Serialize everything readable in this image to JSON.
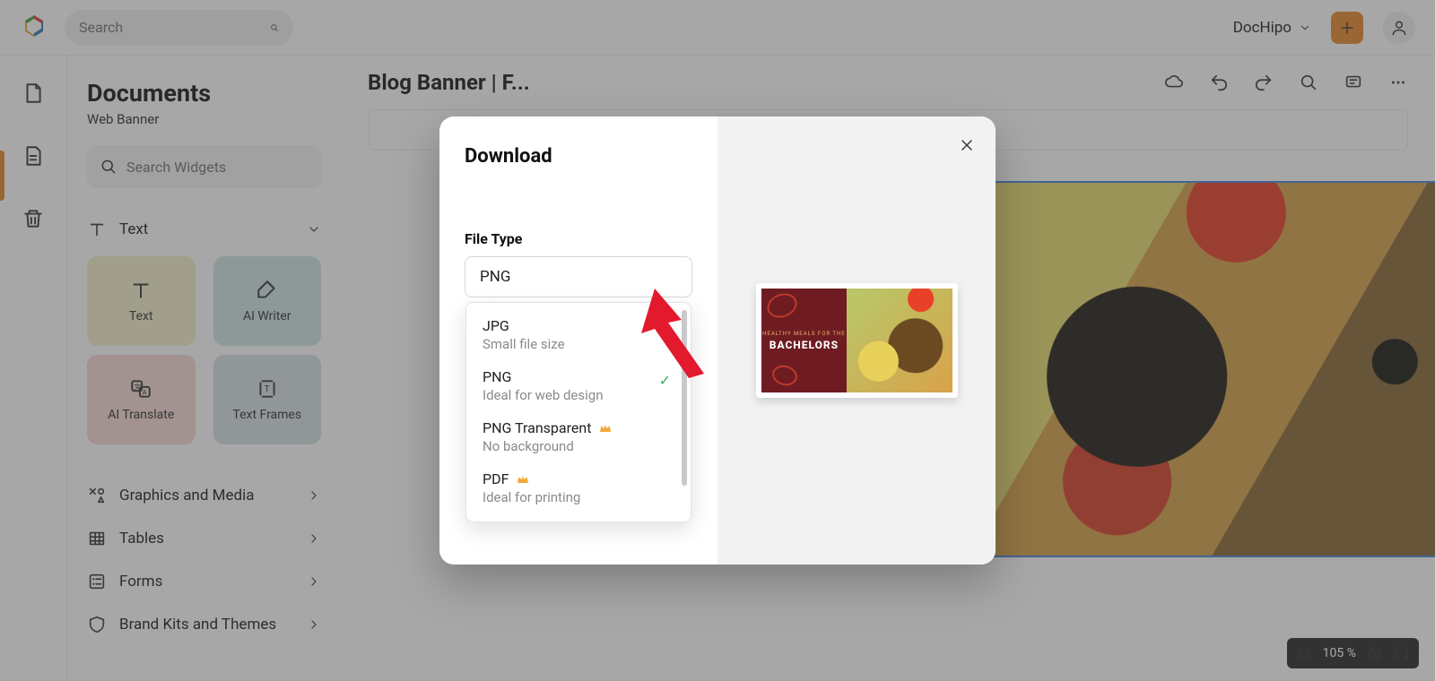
{
  "topbar": {
    "search_placeholder": "Search",
    "workspace_name": "DocHipo"
  },
  "sidebar": {
    "title": "Documents",
    "subtitle": "Web Banner",
    "widget_search_placeholder": "Search Widgets",
    "text_section_label": "Text",
    "cards": [
      {
        "label": "Text"
      },
      {
        "label": "AI Writer"
      },
      {
        "label": "AI Translate"
      },
      {
        "label": "Text Frames"
      }
    ],
    "sections": [
      "Graphics and Media",
      "Tables",
      "Forms",
      "Brand Kits and Themes"
    ]
  },
  "canvas": {
    "doc_title": "Blog Banner | F...",
    "zoom_label": "105 %"
  },
  "modal": {
    "title": "Download",
    "file_type_label": "File Type",
    "selected": "PNG",
    "options": [
      {
        "title": "JPG",
        "sub": "Small file size",
        "premium": false,
        "selected": false
      },
      {
        "title": "PNG",
        "sub": "Ideal for web design",
        "premium": false,
        "selected": true
      },
      {
        "title": "PNG Transparent",
        "sub": "No background",
        "premium": true,
        "selected": false
      },
      {
        "title": "PDF",
        "sub": "Ideal for printing",
        "premium": true,
        "selected": false
      }
    ],
    "preview": {
      "line1": "HEALTHY MEALS FOR THE",
      "line2": "BACHELORS"
    }
  }
}
